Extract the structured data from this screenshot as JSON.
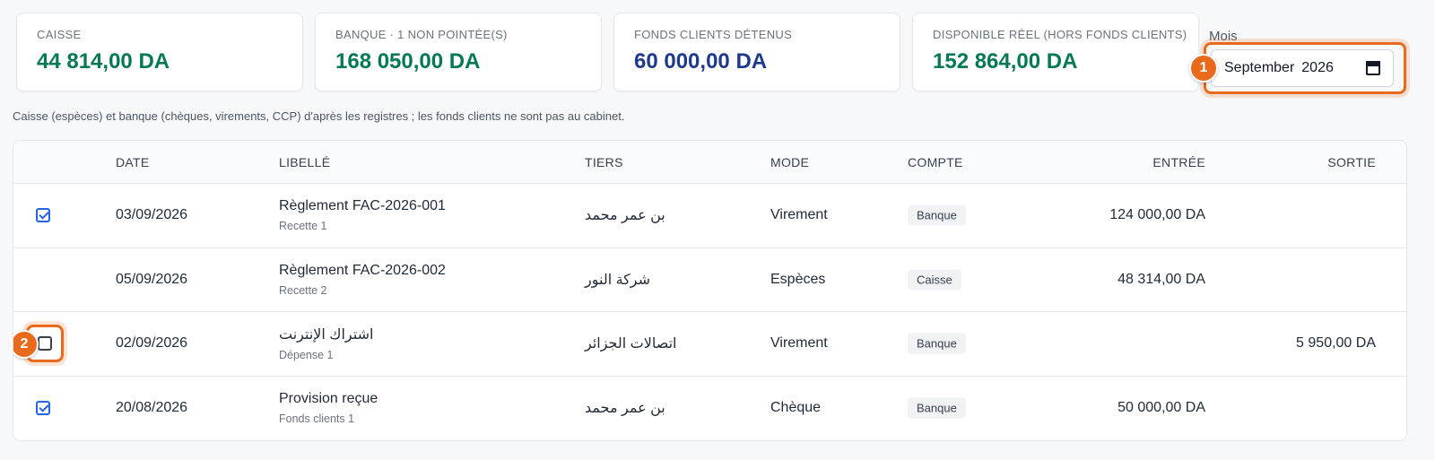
{
  "cards": [
    {
      "label": "CAISSE",
      "value": "44 814,00 DA",
      "color": "#047857"
    },
    {
      "label": "BANQUE · 1 NON POINTÉE(S)",
      "value": "168 050,00 DA",
      "color": "#047857"
    },
    {
      "label": "FONDS CLIENTS DÉTENUS",
      "value": "60 000,00 DA",
      "color": "#1e3a8a"
    },
    {
      "label": "DISPONIBLE RÉEL (HORS FONDS CLIENTS)",
      "value": "152 864,00 DA",
      "color": "#047857"
    }
  ],
  "month": {
    "label": "Mois",
    "month_name": "September",
    "year": "2026",
    "icon": "calendar-icon"
  },
  "markers": {
    "first": "1",
    "second": "2",
    "color": "#ea6a1c"
  },
  "note": "Caisse (espèces) et banque (chèques, virements, CCP) d'après les registres ; les fonds clients ne sont pas au cabinet.",
  "table": {
    "headers": {
      "date": "DATE",
      "libelle": "LIBELLÉ",
      "tiers": "TIERS",
      "mode": "MODE",
      "compte": "COMPTE",
      "entree": "ENTRÉE",
      "sortie": "SORTIE"
    },
    "rows": [
      {
        "pointed": "checked",
        "date": "03/09/2026",
        "libelle": "Règlement FAC-2026-001",
        "sub": "Recette 1",
        "tiers": "بن عمر محمد",
        "mode": "Virement",
        "compte": "Banque",
        "entree": "124 000,00 DA",
        "sortie": ""
      },
      {
        "pointed": "none",
        "date": "05/09/2026",
        "libelle": "Règlement FAC-2026-002",
        "sub": "Recette 2",
        "tiers": "شركة النور",
        "mode": "Espèces",
        "compte": "Caisse",
        "entree": "48 314,00 DA",
        "sortie": ""
      },
      {
        "pointed": "unchecked",
        "date": "02/09/2026",
        "libelle": "اشتراك الإنترنت",
        "sub": "Dépense 1",
        "tiers": "اتصالات الجزائر",
        "mode": "Virement",
        "compte": "Banque",
        "entree": "",
        "sortie": "5 950,00 DA"
      },
      {
        "pointed": "checked",
        "date": "20/08/2026",
        "libelle": "Provision reçue",
        "sub": "Fonds clients 1",
        "tiers": "بن عمر محمد",
        "mode": "Chèque",
        "compte": "Banque",
        "entree": "50 000,00 DA",
        "sortie": ""
      }
    ]
  }
}
